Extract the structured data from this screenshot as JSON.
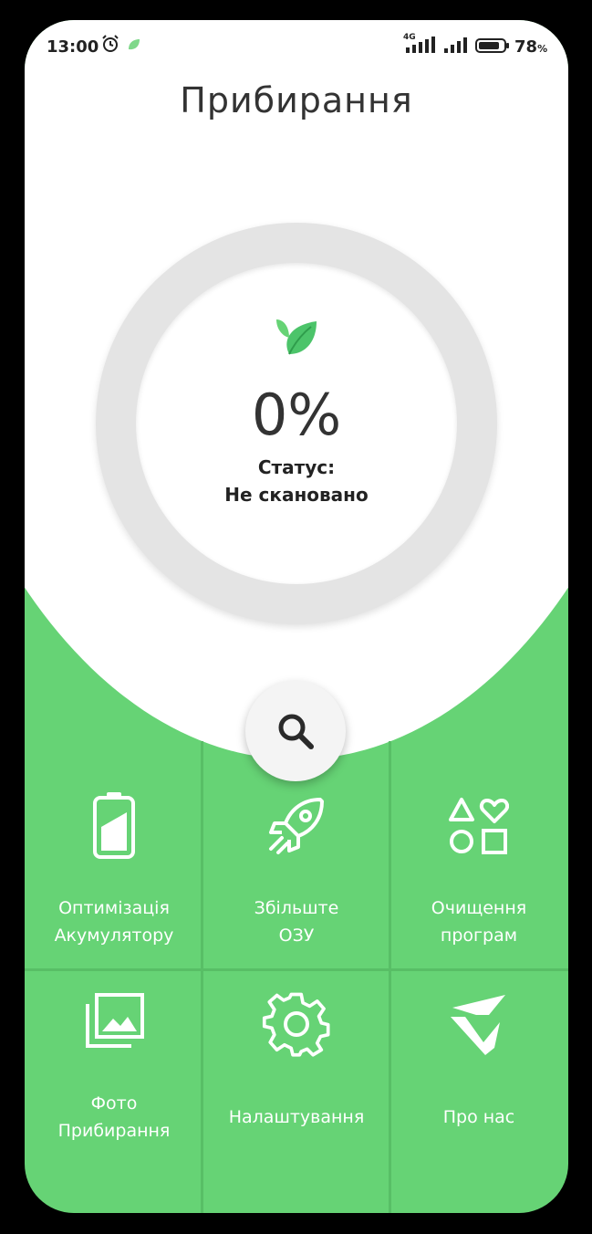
{
  "status_bar": {
    "time": "13:00",
    "network": "4G",
    "battery_percent": "78",
    "percent_sign": "%"
  },
  "page_title": "Прибирання",
  "scan": {
    "percent": "0%",
    "status_label": "Статус:",
    "status_value": "Не скановано"
  },
  "menu": {
    "items": [
      {
        "label_line1": "Оптимізація",
        "label_line2": "Акумулятору",
        "icon": "battery-icon"
      },
      {
        "label_line1": "Збільште",
        "label_line2": "ОЗУ",
        "icon": "rocket-icon"
      },
      {
        "label_line1": "Очищення",
        "label_line2": "програм",
        "icon": "apps-shapes-icon"
      },
      {
        "label_line1": "Фото",
        "label_line2": "Прибирання",
        "icon": "photo-gallery-icon"
      },
      {
        "label_line1": "Налаштування",
        "label_line2": "",
        "icon": "gear-icon"
      },
      {
        "label_line1": "Про нас",
        "label_line2": "",
        "icon": "logo-icon"
      }
    ]
  },
  "colors": {
    "accent_green": "#66d375",
    "background_white": "#ffffff",
    "ring_gray": "#e4e4e4",
    "text_dark": "#333333"
  }
}
